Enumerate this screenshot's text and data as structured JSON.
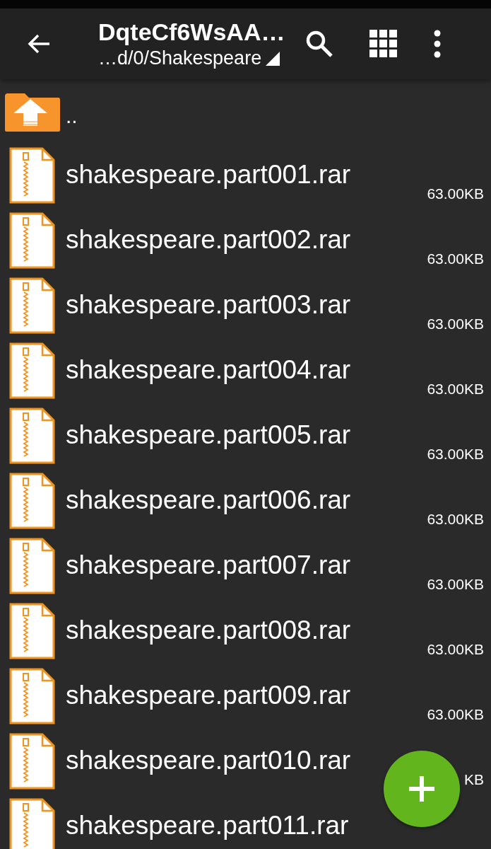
{
  "app_bar": {
    "title": "DqteCf6WsAA…",
    "path": "…d/0/Shakespeare"
  },
  "parent_entry": {
    "label": ".."
  },
  "files": [
    {
      "name": "shakespeare.part001.rar",
      "size": "63.00KB"
    },
    {
      "name": "shakespeare.part002.rar",
      "size": "63.00KB"
    },
    {
      "name": "shakespeare.part003.rar",
      "size": "63.00KB"
    },
    {
      "name": "shakespeare.part004.rar",
      "size": "63.00KB"
    },
    {
      "name": "shakespeare.part005.rar",
      "size": "63.00KB"
    },
    {
      "name": "shakespeare.part006.rar",
      "size": "63.00KB"
    },
    {
      "name": "shakespeare.part007.rar",
      "size": "63.00KB"
    },
    {
      "name": "shakespeare.part008.rar",
      "size": "63.00KB"
    },
    {
      "name": "shakespeare.part009.rar",
      "size": "63.00KB"
    },
    {
      "name": "shakespeare.part010.rar",
      "size": "KB"
    },
    {
      "name": "shakespeare.part011.rar"
    }
  ]
}
